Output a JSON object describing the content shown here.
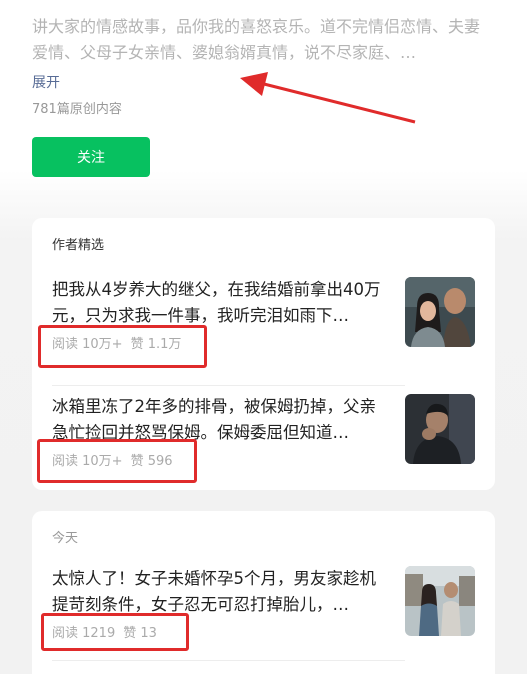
{
  "profile": {
    "description": "讲大家的情感故事，品你我的喜怒哀乐。道不完情侣恋情、夫妻爱情、父母子女亲情、婆媳翁婿真情，说不尽家庭、…",
    "expand_label": "展开",
    "article_count": "781篇原创内容",
    "follow_label": "关注"
  },
  "featured": {
    "section_title": "作者精选",
    "articles": [
      {
        "title": "把我从4岁养大的继父，在我结婚前拿出40万元，只为求我一件事，我听完泪如雨下…",
        "reads": "阅读 10万+",
        "likes": "赞 1.1万",
        "thumb_icon": "elderly-man-and-young-woman-photo"
      },
      {
        "title": "冰箱里冻了2年多的排骨，被保姆扔掉，父亲急忙捡回并怒骂保姆。保姆委屈但知道…",
        "reads": "阅读 10万+",
        "likes": "赞 596",
        "thumb_icon": "distressed-man-photo"
      }
    ]
  },
  "today": {
    "section_title": "今天",
    "articles": [
      {
        "title": "太惊人了！女子未婚怀孕5个月，男友家趁机提苛刻条件，女子忍无可忍打掉胎儿，…",
        "reads": "阅读 1219",
        "likes": "赞 13",
        "thumb_icon": "couple-outdoors-photo"
      }
    ]
  },
  "colors": {
    "accent_green": "#07c160",
    "link_blue": "#576b95",
    "annotation_red": "#e02b2b"
  }
}
